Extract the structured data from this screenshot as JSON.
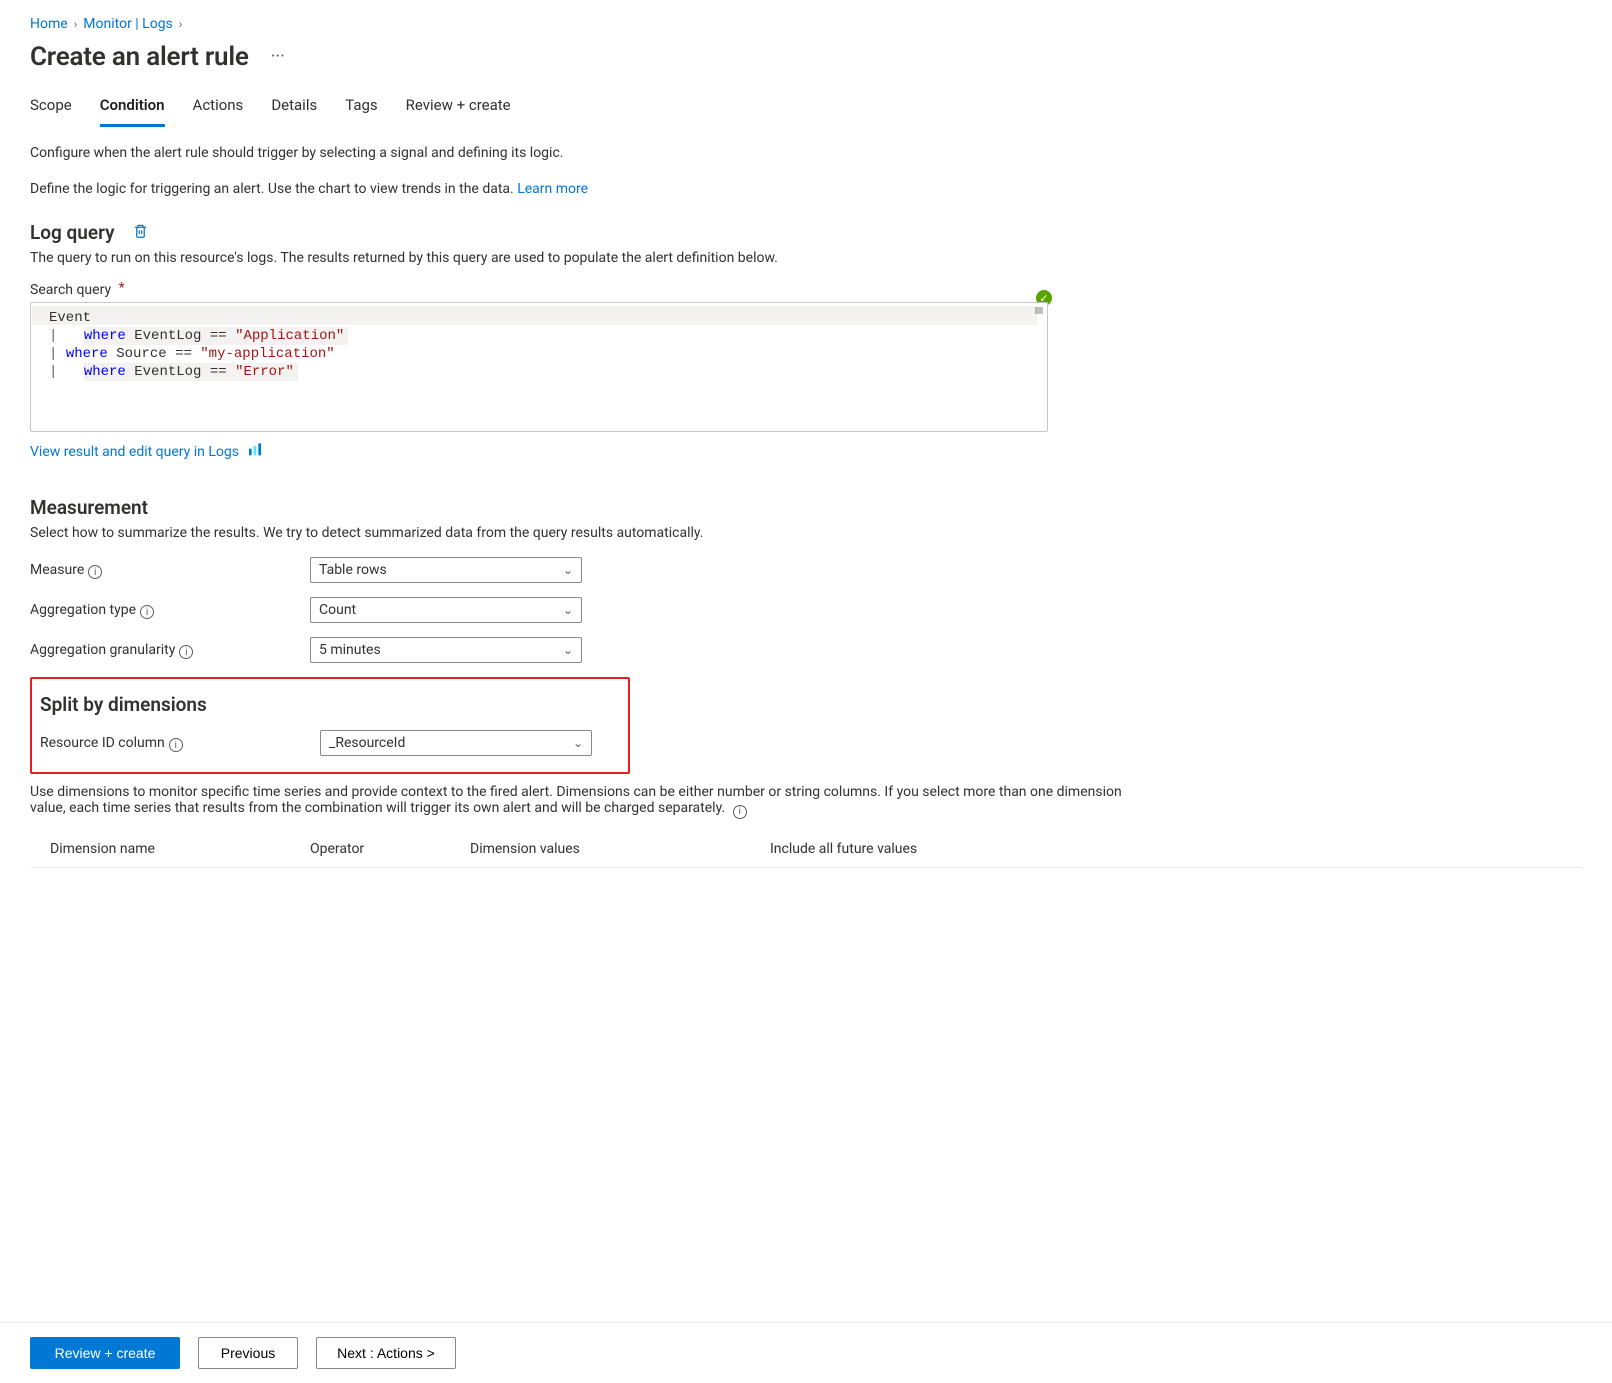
{
  "breadcrumb": {
    "items": [
      "Home",
      "Monitor | Logs"
    ]
  },
  "page": {
    "title": "Create an alert rule"
  },
  "tabs": {
    "items": [
      {
        "label": "Scope",
        "active": false
      },
      {
        "label": "Condition",
        "active": true
      },
      {
        "label": "Actions",
        "active": false
      },
      {
        "label": "Details",
        "active": false
      },
      {
        "label": "Tags",
        "active": false
      },
      {
        "label": "Review + create",
        "active": false
      }
    ]
  },
  "intro": {
    "line1": "Configure when the alert rule should trigger by selecting a signal and defining its logic.",
    "line2": "Define the logic for triggering an alert. Use the chart to view trends in the data. ",
    "learnMore": "Learn more"
  },
  "logQuery": {
    "heading": "Log query",
    "desc": "The query to run on this resource's logs. The results returned by this query are used to populate the alert definition below.",
    "searchLabel": "Search query",
    "viewLink": "View result and edit query in Logs",
    "query": {
      "line1_table": "Event",
      "line2_keyword": "where",
      "line2_field": "EventLog",
      "line2_op": "==",
      "line2_string": "\"Application\"",
      "line3_keyword": "where",
      "line3_field": "Source",
      "line3_op": "==",
      "line3_string": "\"my-application\"",
      "line4_keyword": "where",
      "line4_field": "EventLog",
      "line4_op": "==",
      "line4_string": "\"Error\""
    }
  },
  "measurement": {
    "heading": "Measurement",
    "desc": "Select how to summarize the results. We try to detect summarized data from the query results automatically.",
    "measureLabel": "Measure",
    "measureValue": "Table rows",
    "aggTypeLabel": "Aggregation type",
    "aggTypeValue": "Count",
    "granLabel": "Aggregation granularity",
    "granValue": "5 minutes"
  },
  "split": {
    "heading": "Split by dimensions",
    "ridLabel": "Resource ID column",
    "ridValue": "_ResourceId",
    "desc": "Use dimensions to monitor specific time series and provide context to the fired alert. Dimensions can be either number or string columns. If you select more than one dimension value, each time series that results from the combination will trigger its own alert and will be charged separately.",
    "cols": {
      "name": "Dimension name",
      "op": "Operator",
      "vals": "Dimension values",
      "future": "Include all future values"
    }
  },
  "footer": {
    "review": "Review + create",
    "prev": "Previous",
    "next": "Next : Actions >"
  }
}
